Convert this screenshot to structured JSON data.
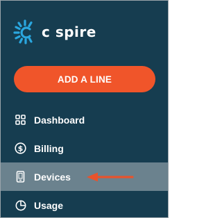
{
  "brand": {
    "name": "c spire",
    "logo_color": "#2aa7df"
  },
  "actions": {
    "add_line_label": "ADD A LINE",
    "add_line_color": "#f0552a"
  },
  "nav": {
    "items": [
      {
        "label": "Dashboard",
        "icon": "dashboard-grid-icon",
        "active": false
      },
      {
        "label": "Billing",
        "icon": "dollar-circle-icon",
        "active": false
      },
      {
        "label": "Devices",
        "icon": "phone-icon",
        "active": true
      },
      {
        "label": "Usage",
        "icon": "pie-chart-icon",
        "active": false
      }
    ]
  },
  "colors": {
    "sidebar_bg": "#163d50",
    "active_bg": "#6b828e",
    "annotation_arrow": "#e8532c"
  }
}
